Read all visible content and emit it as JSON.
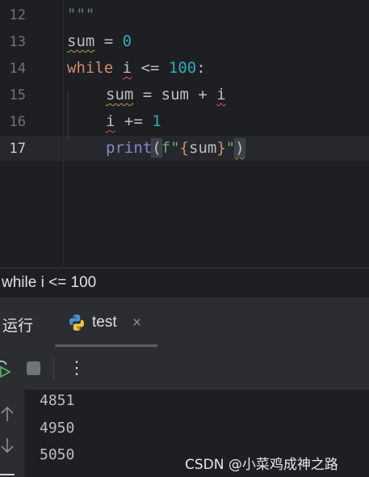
{
  "editor": {
    "lines": [
      {
        "num": "12",
        "text": "\"\"\""
      },
      {
        "num": "13",
        "text": "sum = 0"
      },
      {
        "num": "14",
        "text": "while i <= 100:"
      },
      {
        "num": "15",
        "text": "    sum = sum + i"
      },
      {
        "num": "16",
        "text": "    i += 1"
      },
      {
        "num": "17",
        "text": "    print(f\"{sum}\")"
      }
    ],
    "tokens": {
      "l12_doc": "\"\"\"",
      "l13_sum": "sum",
      "l13_eq": " = ",
      "l13_zero": "0",
      "l14_while": "while",
      "l14_i": "i",
      "l14_op": " <= ",
      "l14_100": "100",
      "l14_colon": ":",
      "l15_sum": "sum",
      "l15_rest": " = sum + ",
      "l15_i": "i",
      "l16_i": "i",
      "l16_op": " += ",
      "l16_one": "1",
      "l17_print": "print",
      "l17_lparen": "(",
      "l17_f": "f\"",
      "l17_lbrace": "{",
      "l17_sum": "sum",
      "l17_rbrace": "}",
      "l17_quote": "\"",
      "l17_rparen": ")"
    },
    "active_line": "17"
  },
  "breadcrumb": "while i <= 100",
  "run_panel": {
    "title": "运行",
    "tab_label": "test",
    "tab_close": "×",
    "more_label": "⋮"
  },
  "console": {
    "output": [
      "4851",
      "4950",
      "5050"
    ]
  },
  "watermark": "CSDN @小菜鸡成神之路",
  "colors": {
    "background": "#1e1f22",
    "keyword": "#cf8e6d",
    "number": "#2aacb8",
    "string": "#6aab73"
  }
}
